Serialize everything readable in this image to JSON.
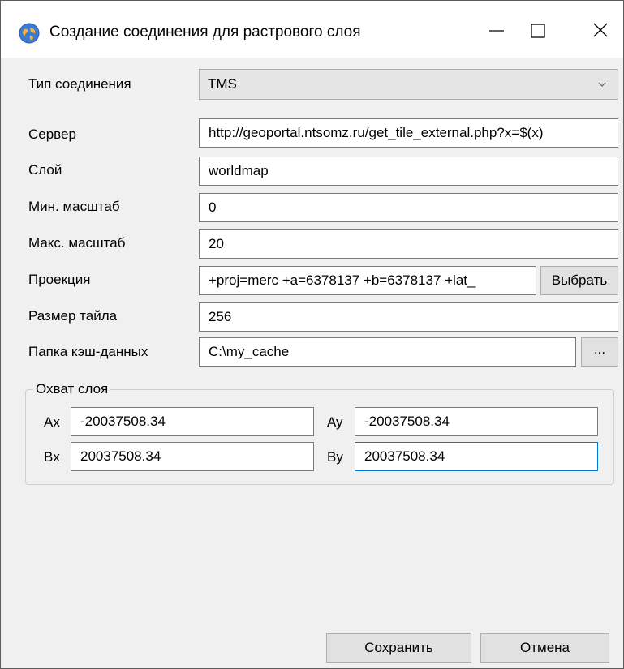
{
  "window": {
    "title": "Создание соединения для растрового слоя",
    "icon": "globe-icon"
  },
  "form": {
    "connection_type_label": "Тип соединения",
    "connection_type_value": "TMS",
    "server_label": "Сервер",
    "server_value": "http://geoportal.ntsomz.ru/get_tile_external.php?x=$(x)",
    "layer_label": "Слой",
    "layer_value": "worldmap",
    "min_scale_label": "Мин. масштаб",
    "min_scale_value": "0",
    "max_scale_label": "Макс. масштаб",
    "max_scale_value": "20",
    "projection_label": "Проекция",
    "projection_value": "+proj=merc +a=6378137 +b=6378137 +lat_",
    "projection_button": "Выбрать",
    "tile_size_label": "Размер тайла",
    "tile_size_value": "256",
    "cache_folder_label": "Папка кэш-данных",
    "cache_folder_value": "C:\\my_cache",
    "browse_button": "..."
  },
  "extent": {
    "title": "Охват слоя",
    "ax_label": "Ax",
    "ax_value": "-20037508.34",
    "ay_label": "Ay",
    "ay_value": "-20037508.34",
    "bx_label": "Bx",
    "bx_value": "20037508.34",
    "by_label": "By",
    "by_value": "20037508.34"
  },
  "buttons": {
    "save": "Сохранить",
    "cancel": "Отмена"
  },
  "colors": {
    "focus": "#0078d7",
    "window_bg": "#f0f0f0"
  }
}
